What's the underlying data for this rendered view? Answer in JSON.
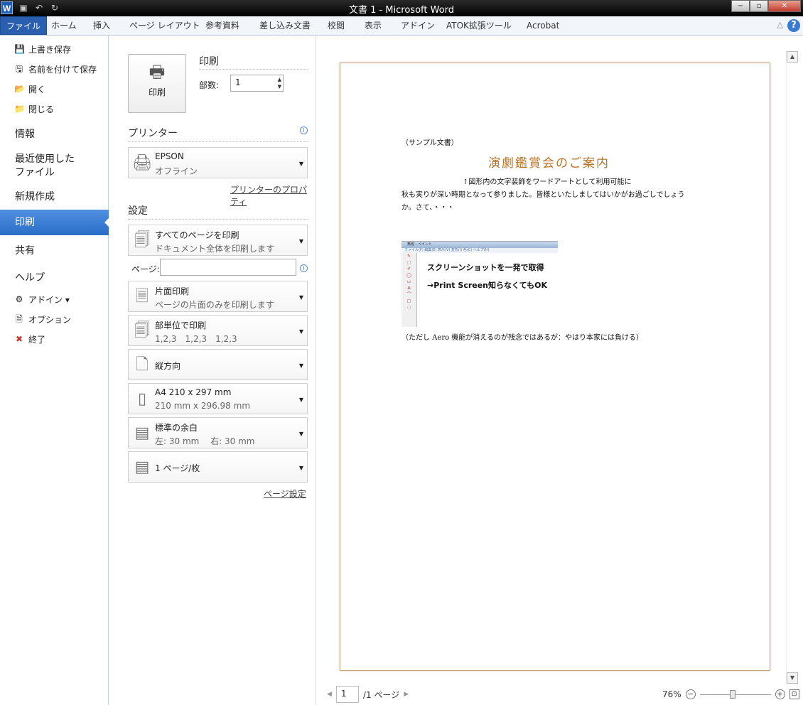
{
  "window": {
    "title": "文書 1 - Microsoft Word",
    "logo": "W",
    "controls": {
      "minimize": "−",
      "maximize": "▫",
      "close": "✕"
    }
  },
  "qat": {
    "save_icon": "save-icon",
    "undo_icon": "undo-icon",
    "redo_icon": "redo-icon"
  },
  "ribbon": {
    "tabs": [
      "ファイル",
      "ホーム",
      "挿入",
      "ページ レイアウト",
      "参考資料",
      "差し込み文書",
      "校閲",
      "表示",
      "アドイン",
      "ATOK拡張ツール",
      "Acrobat"
    ],
    "help": "?",
    "collapse": "△"
  },
  "nav": {
    "top": [
      {
        "label": "上書き保存",
        "icon": "save-icon",
        "glyph": "💾"
      },
      {
        "label": "名前を付けて保存",
        "icon": "save-as-icon",
        "glyph": "🖫"
      },
      {
        "label": "開く",
        "icon": "open-folder-icon",
        "glyph": "📂"
      },
      {
        "label": "閉じる",
        "icon": "close-folder-icon",
        "glyph": "📁"
      }
    ],
    "info": "情報",
    "recent_line1": "最近使用した",
    "recent_line2": "ファイル",
    "new": "新規作成",
    "print": "印刷",
    "share": "共有",
    "help": "ヘルプ",
    "bottom": [
      {
        "label": "アドイン ▾",
        "icon": "addin-icon",
        "glyph": "⚙"
      },
      {
        "label": "オプション",
        "icon": "options-icon",
        "glyph": "🗎"
      },
      {
        "label": "終了",
        "icon": "exit-icon",
        "glyph": "✖"
      }
    ]
  },
  "print": {
    "button_label": "印刷",
    "section_title": "印刷",
    "copies_label": "部数:",
    "copies_value": "1",
    "printer_heading": "プリンター",
    "printer_name": "EPSON",
    "printer_status": "オフライン",
    "printer_properties": "プリンターのプロパティ",
    "settings_heading": "設定",
    "range_title": "すべてのページを印刷",
    "range_desc": "ドキュメント全体を印刷します",
    "pages_label": "ページ:",
    "pages_value": "",
    "sided_title": "片面印刷",
    "sided_desc": "ページの片面のみを印刷します",
    "collate_title": "部単位で印刷",
    "collate_desc": "1,2,3　1,2,3　1,2,3",
    "orientation_title": "縦方向",
    "paper_title": "A4 210 x 297 mm",
    "paper_desc": "210 mm x 296.98 mm",
    "margins_title": "標準の余白",
    "margins_desc": "左:  30 mm　 右:  30 mm",
    "persheet_title": "1 ページ/枚",
    "page_setup": "ページ設定"
  },
  "document": {
    "sample_label": "（サンプル文書）",
    "title": "演劇鑑賞会のご案内",
    "note": "↑図形内の文字装飾をワードアートとして利用可能に",
    "body_line1": "秋も実りが深い時期となって参りました。皆様といたしましてはいかがお過ごしでしょう",
    "body_line2": "か。さて、・・・",
    "screenshot_bar": "無題 - ペイント",
    "screenshot_menu": "ファイル(F)  編集(E)  表示(V)  変形(I)  色(C)  ヘルプ(H)",
    "screenshot_line1": "スクリーンショットを一発で取得",
    "screenshot_line2": "→Print Screen知らなくてもOK",
    "footer_text": "（ただし Aero 機能が消えるのが残念ではあるが：やはり本家には負ける）"
  },
  "footer": {
    "current_page": "1",
    "page_total": "/1 ページ",
    "zoom_percent": "76%",
    "zoom_level": 0.76
  }
}
